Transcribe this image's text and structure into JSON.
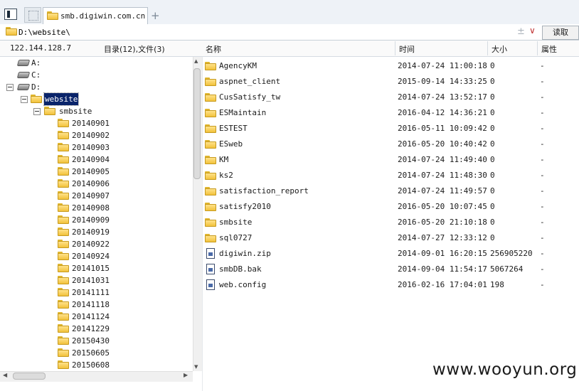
{
  "tabs": {
    "active_title": "smb.digiwin.com.cn",
    "add_label": "+"
  },
  "address": {
    "path": "D:\\website\\",
    "plus": "±",
    "dropdown": "∨",
    "read_button": "读取"
  },
  "status": {
    "host": "122.144.128.7",
    "counts": "目录(12),文件(3)"
  },
  "columns": {
    "name": "名称",
    "time": "时间",
    "size": "大小",
    "attr": "属性"
  },
  "tree": {
    "drives": [
      {
        "label": "A:"
      },
      {
        "label": "C:"
      },
      {
        "label": "D:"
      }
    ],
    "website": "website",
    "smbsite": "smbsite",
    "folders": [
      "20140901",
      "20140902",
      "20140903",
      "20140904",
      "20140905",
      "20140906",
      "20140907",
      "20140908",
      "20140909",
      "20140919",
      "20140922",
      "20140924",
      "20141015",
      "20141031",
      "20141111",
      "20141118",
      "20141124",
      "20141229",
      "20150430",
      "20150605",
      "20150608"
    ],
    "expander": "-"
  },
  "files": [
    {
      "name": "AgencyKM",
      "time": "2014-07-24 11:00:18",
      "size": "0",
      "attr": "-",
      "type": "folder"
    },
    {
      "name": "aspnet_client",
      "time": "2015-09-14 14:33:25",
      "size": "0",
      "attr": "-",
      "type": "folder"
    },
    {
      "name": "CusSatisfy_tw",
      "time": "2014-07-24 13:52:17",
      "size": "0",
      "attr": "-",
      "type": "folder"
    },
    {
      "name": "ESMaintain",
      "time": "2016-04-12 14:36:21",
      "size": "0",
      "attr": "-",
      "type": "folder"
    },
    {
      "name": "ESTEST",
      "time": "2016-05-11 10:09:42",
      "size": "0",
      "attr": "-",
      "type": "folder"
    },
    {
      "name": "ESweb",
      "time": "2016-05-20 10:40:42",
      "size": "0",
      "attr": "-",
      "type": "folder"
    },
    {
      "name": "KM",
      "time": "2014-07-24 11:49:40",
      "size": "0",
      "attr": "-",
      "type": "folder"
    },
    {
      "name": "ks2",
      "time": "2014-07-24 11:48:30",
      "size": "0",
      "attr": "-",
      "type": "folder"
    },
    {
      "name": "satisfaction_report",
      "time": "2014-07-24 11:49:57",
      "size": "0",
      "attr": "-",
      "type": "folder"
    },
    {
      "name": "satisfy2010",
      "time": "2016-05-20 10:07:45",
      "size": "0",
      "attr": "-",
      "type": "folder"
    },
    {
      "name": "smbsite",
      "time": "2016-05-20 21:10:18",
      "size": "0",
      "attr": "-",
      "type": "folder"
    },
    {
      "name": "sql0727",
      "time": "2014-07-27 12:33:12",
      "size": "0",
      "attr": "-",
      "type": "folder"
    },
    {
      "name": "digiwin.zip",
      "time": "2014-09-01 16:20:15",
      "size": "256905220",
      "attr": "-",
      "type": "file"
    },
    {
      "name": "smbDB.bak",
      "time": "2014-09-04 11:54:17",
      "size": "5067264",
      "attr": "-",
      "type": "file"
    },
    {
      "name": "web.config",
      "time": "2016-02-16 17:04:01",
      "size": "198",
      "attr": "-",
      "type": "file"
    }
  ],
  "scroll": {
    "up": "▲",
    "down": "▼",
    "left": "◀",
    "right": "▶"
  },
  "watermark": "www.wooyun.org",
  "colors": {
    "selection": "#0a246a",
    "folder": "#f2c23b",
    "dropdown_accent": "#c03030"
  }
}
